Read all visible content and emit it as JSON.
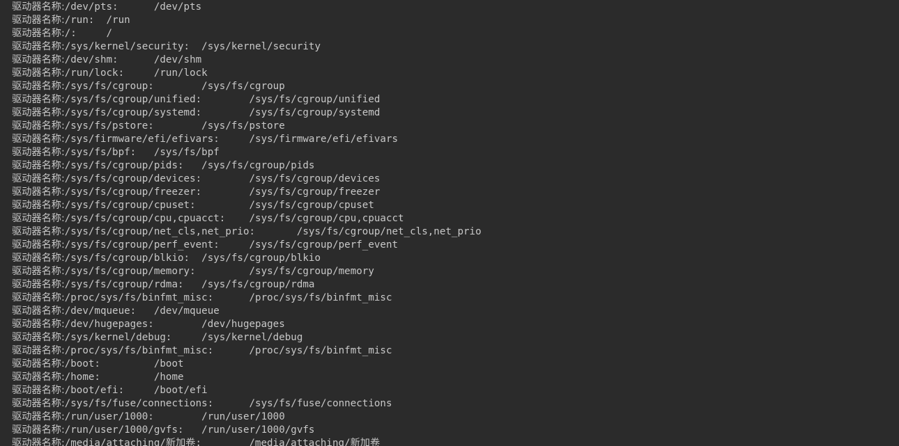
{
  "terminal": {
    "lines": [
      {
        "label": "驱动器名称:",
        "text": "/dev/pts:      /dev/pts"
      },
      {
        "label": "驱动器名称:",
        "text": "/run:  /run"
      },
      {
        "label": "驱动器名称:",
        "text": "/:     /"
      },
      {
        "label": "驱动器名称:",
        "text": "/sys/kernel/security:  /sys/kernel/security"
      },
      {
        "label": "驱动器名称:",
        "text": "/dev/shm:      /dev/shm"
      },
      {
        "label": "驱动器名称:",
        "text": "/run/lock:     /run/lock"
      },
      {
        "label": "驱动器名称:",
        "text": "/sys/fs/cgroup:        /sys/fs/cgroup"
      },
      {
        "label": "驱动器名称:",
        "text": "/sys/fs/cgroup/unified:        /sys/fs/cgroup/unified"
      },
      {
        "label": "驱动器名称:",
        "text": "/sys/fs/cgroup/systemd:        /sys/fs/cgroup/systemd"
      },
      {
        "label": "驱动器名称:",
        "text": "/sys/fs/pstore:        /sys/fs/pstore"
      },
      {
        "label": "驱动器名称:",
        "text": "/sys/firmware/efi/efivars:     /sys/firmware/efi/efivars"
      },
      {
        "label": "驱动器名称:",
        "text": "/sys/fs/bpf:   /sys/fs/bpf"
      },
      {
        "label": "驱动器名称:",
        "text": "/sys/fs/cgroup/pids:   /sys/fs/cgroup/pids"
      },
      {
        "label": "驱动器名称:",
        "text": "/sys/fs/cgroup/devices:        /sys/fs/cgroup/devices"
      },
      {
        "label": "驱动器名称:",
        "text": "/sys/fs/cgroup/freezer:        /sys/fs/cgroup/freezer"
      },
      {
        "label": "驱动器名称:",
        "text": "/sys/fs/cgroup/cpuset:         /sys/fs/cgroup/cpuset"
      },
      {
        "label": "驱动器名称:",
        "text": "/sys/fs/cgroup/cpu,cpuacct:    /sys/fs/cgroup/cpu,cpuacct"
      },
      {
        "label": "驱动器名称:",
        "text": "/sys/fs/cgroup/net_cls,net_prio:       /sys/fs/cgroup/net_cls,net_prio"
      },
      {
        "label": "驱动器名称:",
        "text": "/sys/fs/cgroup/perf_event:     /sys/fs/cgroup/perf_event"
      },
      {
        "label": "驱动器名称:",
        "text": "/sys/fs/cgroup/blkio:  /sys/fs/cgroup/blkio"
      },
      {
        "label": "驱动器名称:",
        "text": "/sys/fs/cgroup/memory:         /sys/fs/cgroup/memory"
      },
      {
        "label": "驱动器名称:",
        "text": "/sys/fs/cgroup/rdma:   /sys/fs/cgroup/rdma"
      },
      {
        "label": "驱动器名称:",
        "text": "/proc/sys/fs/binfmt_misc:      /proc/sys/fs/binfmt_misc"
      },
      {
        "label": "驱动器名称:",
        "text": "/dev/mqueue:   /dev/mqueue"
      },
      {
        "label": "驱动器名称:",
        "text": "/dev/hugepages:        /dev/hugepages"
      },
      {
        "label": "驱动器名称:",
        "text": "/sys/kernel/debug:     /sys/kernel/debug"
      },
      {
        "label": "驱动器名称:",
        "text": "/proc/sys/fs/binfmt_misc:      /proc/sys/fs/binfmt_misc"
      },
      {
        "label": "驱动器名称:",
        "text": "/boot:         /boot"
      },
      {
        "label": "驱动器名称:",
        "text": "/home:         /home"
      },
      {
        "label": "驱动器名称:",
        "text": "/boot/efi:     /boot/efi"
      },
      {
        "label": "驱动器名称:",
        "text": "/sys/fs/fuse/connections:      /sys/fs/fuse/connections"
      },
      {
        "label": "驱动器名称:",
        "text": "/run/user/1000:        /run/user/1000"
      },
      {
        "label": "驱动器名称:",
        "text": "/run/user/1000/gvfs:   /run/user/1000/gvfs"
      },
      {
        "label": "驱动器名称:",
        "text": "/media/attaching/新加卷:        /media/attaching/新加卷"
      }
    ]
  },
  "colors": {
    "background": "#2b2b2b",
    "text": "#c8c8c8"
  }
}
